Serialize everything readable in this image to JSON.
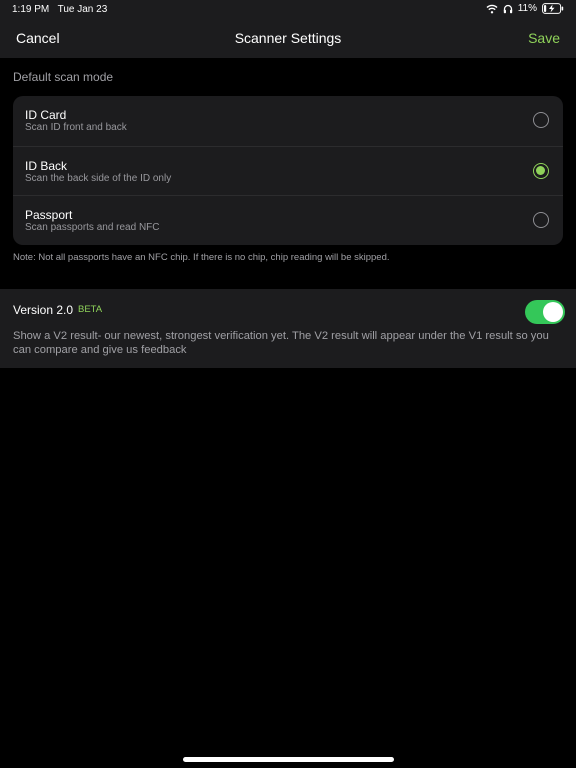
{
  "status_bar": {
    "time": "1:19 PM",
    "date": "Tue Jan 23",
    "battery": "11%",
    "icons": [
      "wifi-icon",
      "headphones-icon",
      "battery-charging-icon"
    ]
  },
  "nav": {
    "cancel_label": "Cancel",
    "title": "Scanner Settings",
    "save_label": "Save"
  },
  "scan_mode": {
    "header": "Default scan mode",
    "options": [
      {
        "title": "ID Card",
        "subtitle": "Scan ID front and back",
        "selected": false
      },
      {
        "title": "ID Back",
        "subtitle": "Scan the back side of the ID only",
        "selected": true
      },
      {
        "title": "Passport",
        "subtitle": "Scan passports and read NFC",
        "selected": false
      }
    ],
    "note": "Note: Not all passports have an NFC chip. If there is no chip, chip reading will be skipped."
  },
  "version": {
    "title": "Version 2.0",
    "badge": "BETA",
    "enabled": true,
    "description": "Show a V2 result- our newest, strongest verification yet. The V2 result will appear under the V1 result so you can compare and give us feedback"
  },
  "colors": {
    "accent": "#8fd25a",
    "toggle_on": "#34c759",
    "panel": "#1c1c1e",
    "background": "#000000"
  }
}
